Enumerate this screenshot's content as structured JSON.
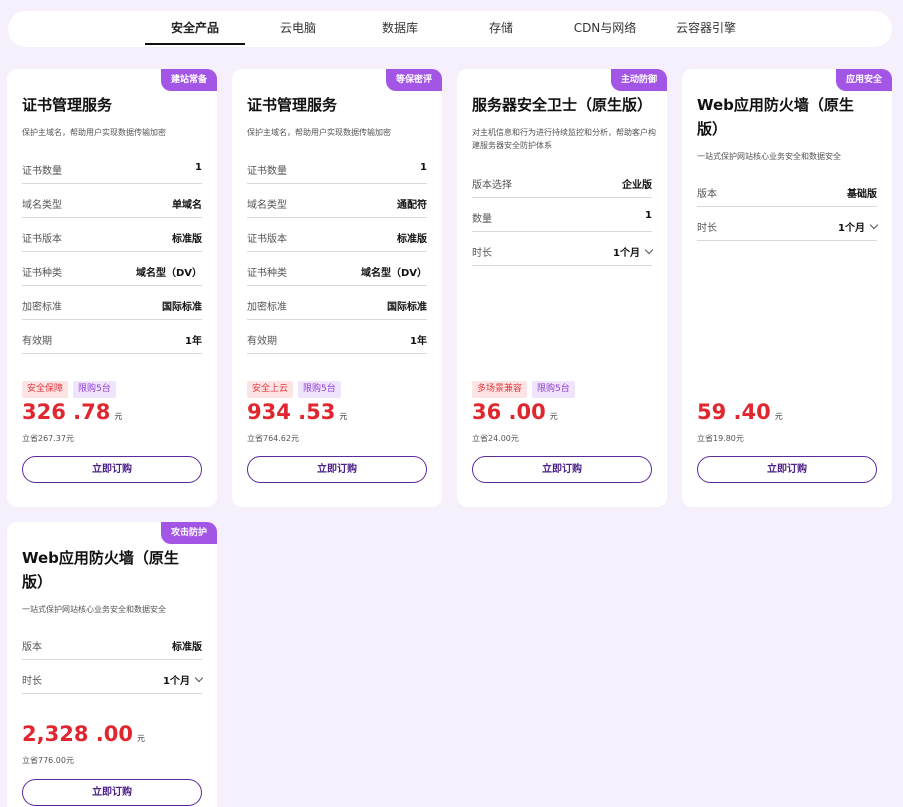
{
  "tabs": [
    "安全产品",
    "云电脑",
    "数据库",
    "存储",
    "CDN与网络",
    "云容器引擎"
  ],
  "cards": [
    {
      "ribbon": "建站常备",
      "title": "证书管理服务",
      "desc": "保护主域名，帮助用户实现数据传输加密",
      "rows": [
        {
          "k": "证书数量",
          "v": "1"
        },
        {
          "k": "域名类型",
          "v": "单域名"
        },
        {
          "k": "证书版本",
          "v": "标准版"
        },
        {
          "k": "证书种类",
          "v": "域名型（DV）"
        },
        {
          "k": "加密标准",
          "v": "国际标准"
        },
        {
          "k": "有效期",
          "v": "1年"
        }
      ],
      "tags": [
        "安全保障",
        "限购5台"
      ],
      "price": "326 .78",
      "unit": "元",
      "save": "立省267.37元",
      "button": "立即订购"
    },
    {
      "ribbon": "等保密评",
      "title": "证书管理服务",
      "desc": "保护主域名，帮助用户实现数据传输加密",
      "rows": [
        {
          "k": "证书数量",
          "v": "1"
        },
        {
          "k": "域名类型",
          "v": "通配符"
        },
        {
          "k": "证书版本",
          "v": "标准版"
        },
        {
          "k": "证书种类",
          "v": "域名型（DV）"
        },
        {
          "k": "加密标准",
          "v": "国际标准"
        },
        {
          "k": "有效期",
          "v": "1年"
        }
      ],
      "tags": [
        "安全上云",
        "限购5台"
      ],
      "price": "934 .53",
      "unit": "元",
      "save": "立省764.62元",
      "button": "立即订购"
    },
    {
      "ribbon": "主动防御",
      "title": "服务器安全卫士（原生版）",
      "desc": "对主机信息和行为进行持续监控和分析，帮助客户构建服务器安全防护体系",
      "rows": [
        {
          "k": "版本选择",
          "v": "企业版"
        },
        {
          "k": "数量",
          "v": "1"
        },
        {
          "k": "时长",
          "v": "1个月",
          "select": true
        }
      ],
      "tags": [
        "多场景兼容",
        "限购5台"
      ],
      "price": "36 .00",
      "unit": "元",
      "save": "立省24.00元",
      "button": "立即订购"
    },
    {
      "ribbon": "应用安全",
      "title": "Web应用防火墙（原生版）",
      "desc": "一站式保护网站核心业务安全和数据安全",
      "rows": [
        {
          "k": "版本",
          "v": "基础版"
        },
        {
          "k": "时长",
          "v": "1个月",
          "select": true
        }
      ],
      "tags": [],
      "price": "59 .40",
      "unit": "元",
      "save": "立省19.80元",
      "button": "立即订购"
    },
    {
      "ribbon": "攻击防护",
      "title": "Web应用防火墙（原生版）",
      "desc": "一站式保护网站核心业务安全和数据安全",
      "rows": [
        {
          "k": "版本",
          "v": "标准版"
        },
        {
          "k": "时长",
          "v": "1个月",
          "select": true
        }
      ],
      "tags": [],
      "price": "2,328 .00",
      "unit": "元",
      "save": "立省776.00元",
      "button": "立即订购"
    }
  ]
}
